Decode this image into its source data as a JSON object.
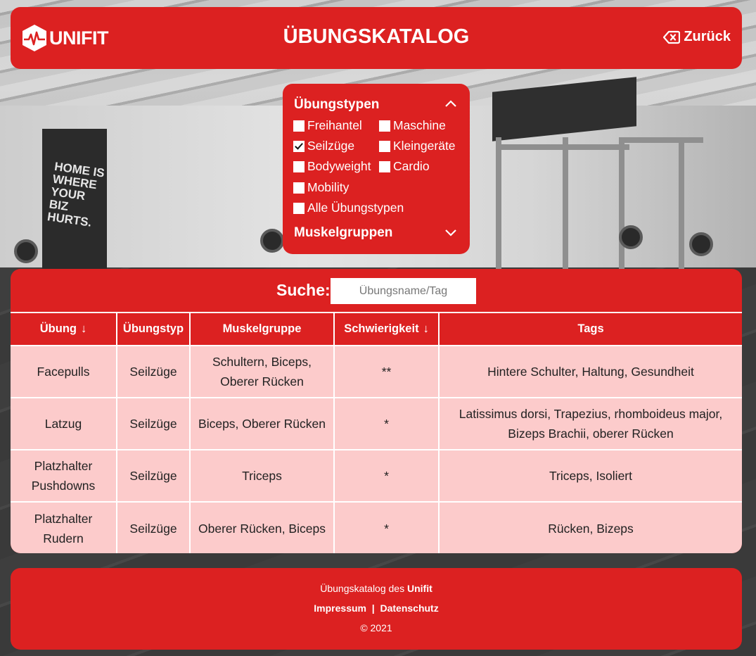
{
  "header": {
    "logo_text": "UNIFIT",
    "title": "ÜBUNGSKATALOG",
    "back_label": "Zurück"
  },
  "background": {
    "banner_text": "HOME IS WHERE YOUR BIZ HURTS."
  },
  "filters": {
    "types_heading": "Übungstypen",
    "muscle_heading": "Muskelgruppen",
    "types": [
      {
        "label": "Freihantel",
        "checked": false
      },
      {
        "label": "Maschine",
        "checked": false
      },
      {
        "label": "Seilzüge",
        "checked": true
      },
      {
        "label": "Kleingeräte",
        "checked": false
      },
      {
        "label": "Bodyweight",
        "checked": false
      },
      {
        "label": "Cardio",
        "checked": false
      },
      {
        "label": "Mobility",
        "checked": false
      },
      {
        "label": "Alle Übungstypen",
        "checked": false
      }
    ]
  },
  "search": {
    "label": "Suche:",
    "placeholder": "Übungsname/Tag",
    "value": ""
  },
  "table": {
    "columns": [
      "Übung",
      "Übungstyp",
      "Muskelgruppe",
      "Schwierigkeit",
      "Tags"
    ],
    "sort_arrow": "↓",
    "rows": [
      {
        "uebung": "Facepulls",
        "typ": "Seilzüge",
        "muskel": "Schultern, Biceps, Oberer Rücken",
        "schwierigkeit": "**",
        "tags": "Hintere Schulter, Haltung, Gesundheit"
      },
      {
        "uebung": "Latzug",
        "typ": "Seilzüge",
        "muskel": "Biceps, Oberer Rücken",
        "schwierigkeit": "*",
        "tags": "Latissimus dorsi, Trapezius, rhomboideus major, Bizeps Brachii, oberer Rücken"
      },
      {
        "uebung": "Platzhalter Pushdowns",
        "typ": "Seilzüge",
        "muskel": "Triceps",
        "schwierigkeit": "*",
        "tags": "Triceps, Isoliert"
      },
      {
        "uebung": "Platzhalter Rudern",
        "typ": "Seilzüge",
        "muskel": "Oberer Rücken, Biceps",
        "schwierigkeit": "*",
        "tags": "Rücken, Bizeps"
      }
    ]
  },
  "footer": {
    "text": "Übungskatalog des",
    "brand": "Unifit",
    "impressum": "Impressum",
    "separator": "|",
    "datenschutz": "Datenschutz",
    "copyright": "© 2021"
  },
  "colors": {
    "brand_red": "#dc2121",
    "row_pink": "#fccbcb"
  }
}
